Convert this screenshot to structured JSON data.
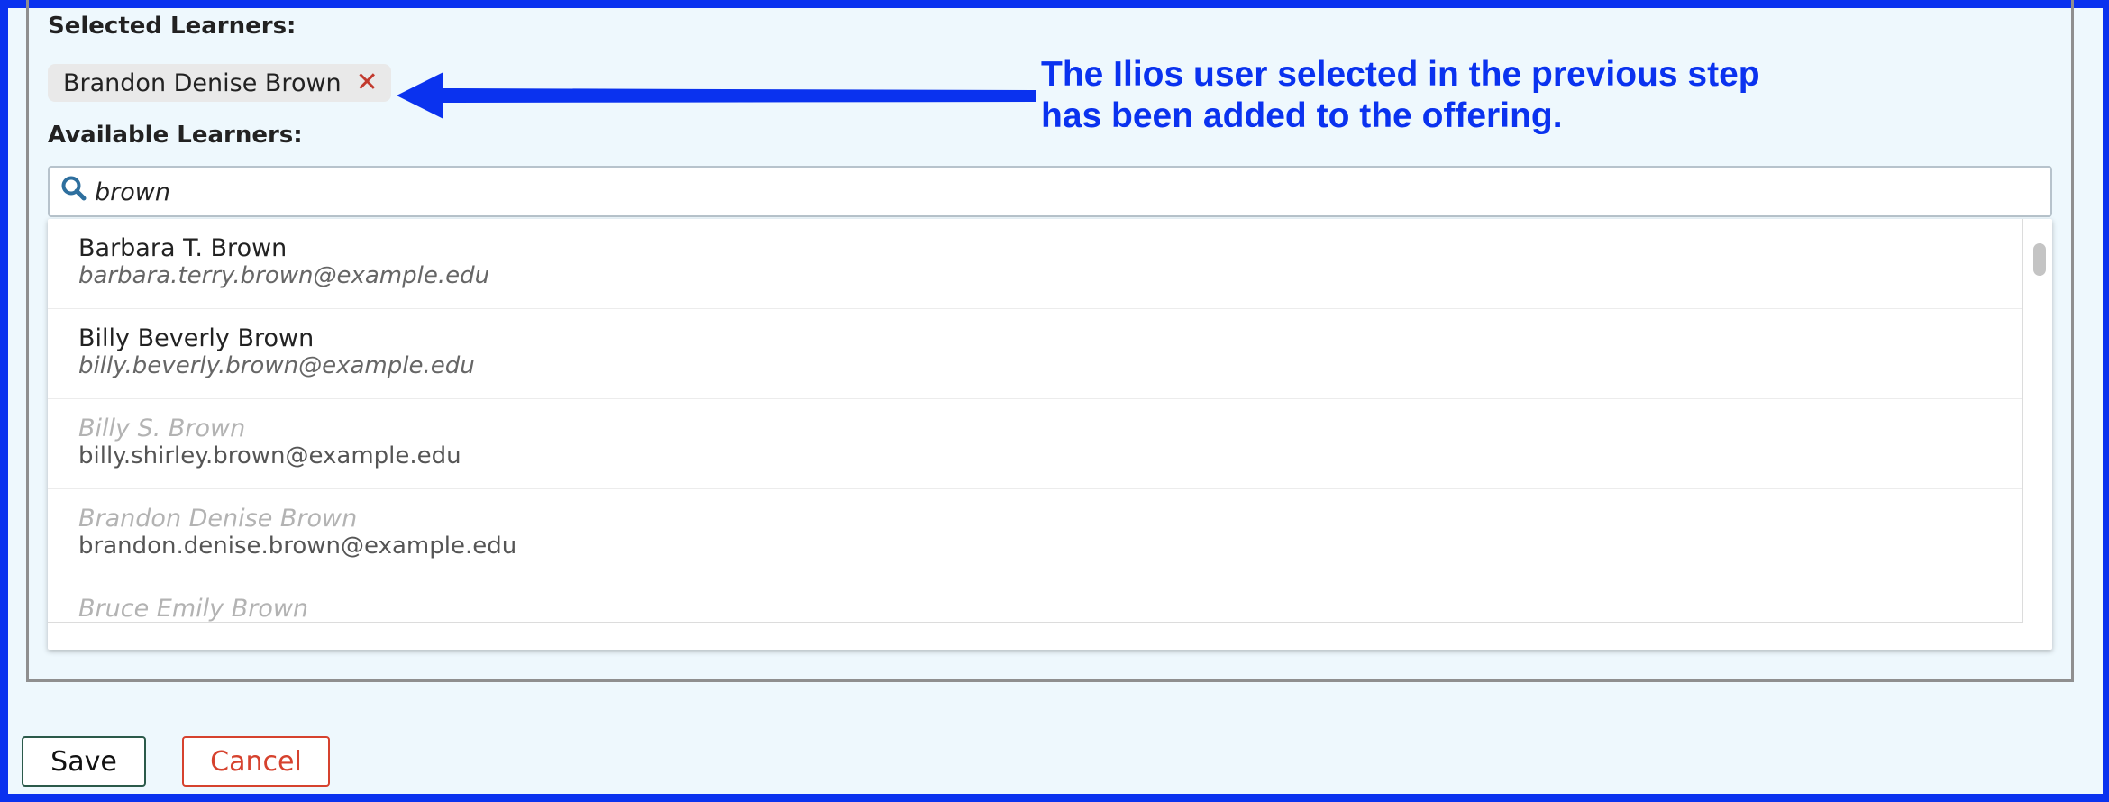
{
  "selected_learners_label": "Selected Learners:",
  "selected_learners": [
    {
      "name": "Brandon Denise Brown",
      "remove_icon": "close-x-icon"
    }
  ],
  "available_learners_label": "Available Learners:",
  "search": {
    "icon": "search-icon",
    "value": "brown"
  },
  "results": [
    {
      "name": "Barbara T. Brown",
      "email": "barbara.terry.brown@example.edu",
      "disabled": false
    },
    {
      "name": "Billy Beverly Brown",
      "email": "billy.beverly.brown@example.edu",
      "disabled": false
    },
    {
      "name": "Billy S. Brown",
      "email": "billy.shirley.brown@example.edu",
      "disabled": true
    },
    {
      "name": "Brandon Denise Brown",
      "email": "brandon.denise.brown@example.edu",
      "disabled": true
    },
    {
      "name": "Bruce Emily Brown",
      "email": "",
      "disabled": true
    }
  ],
  "annotation": {
    "line1": "The Ilios user selected in the previous step",
    "line2": "has been added to the offering.",
    "color": "#0a32ef"
  },
  "buttons": {
    "save": "Save",
    "cancel": "Cancel"
  },
  "colors": {
    "frame": "#0a32ef",
    "background": "#eef8fd",
    "remove": "#c23a2e",
    "cancel": "#d6422e"
  }
}
